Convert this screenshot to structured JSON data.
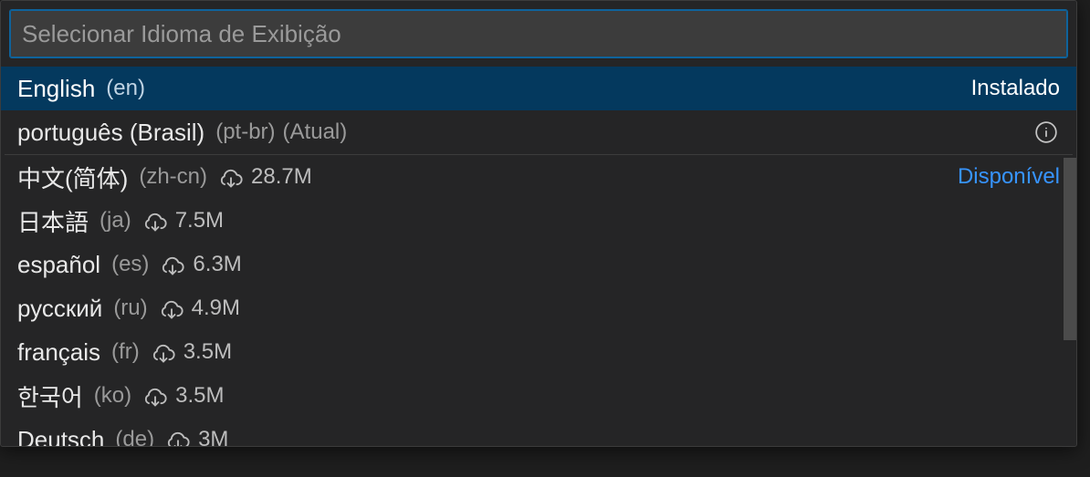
{
  "search": {
    "placeholder": "Selecionar Idioma de Exibição",
    "value": ""
  },
  "labels": {
    "installed": "Instalado",
    "available": "Disponível"
  },
  "items": [
    {
      "name": "English",
      "code": "(en)",
      "current": "",
      "downloads": "",
      "pill": "installed",
      "selected": true,
      "divider_after": false,
      "info": false
    },
    {
      "name": "português (Brasil)",
      "code": "(pt-br)",
      "current": "(Atual)",
      "downloads": "",
      "pill": "",
      "selected": false,
      "divider_after": true,
      "info": true
    },
    {
      "name": "中文(简体)",
      "code": "(zh-cn)",
      "current": "",
      "downloads": "28.7M",
      "pill": "available",
      "selected": false,
      "divider_after": false,
      "info": false
    },
    {
      "name": "日本語",
      "code": "(ja)",
      "current": "",
      "downloads": "7.5M",
      "pill": "",
      "selected": false,
      "divider_after": false,
      "info": false
    },
    {
      "name": "español",
      "code": "(es)",
      "current": "",
      "downloads": "6.3M",
      "pill": "",
      "selected": false,
      "divider_after": false,
      "info": false
    },
    {
      "name": "русский",
      "code": "(ru)",
      "current": "",
      "downloads": "4.9M",
      "pill": "",
      "selected": false,
      "divider_after": false,
      "info": false
    },
    {
      "name": "français",
      "code": "(fr)",
      "current": "",
      "downloads": "3.5M",
      "pill": "",
      "selected": false,
      "divider_after": false,
      "info": false
    },
    {
      "name": "한국어",
      "code": "(ko)",
      "current": "",
      "downloads": "3.5M",
      "pill": "",
      "selected": false,
      "divider_after": false,
      "info": false
    },
    {
      "name": "Deutsch",
      "code": "(de)",
      "current": "",
      "downloads": "3M",
      "pill": "",
      "selected": false,
      "divider_after": false,
      "info": false
    }
  ]
}
